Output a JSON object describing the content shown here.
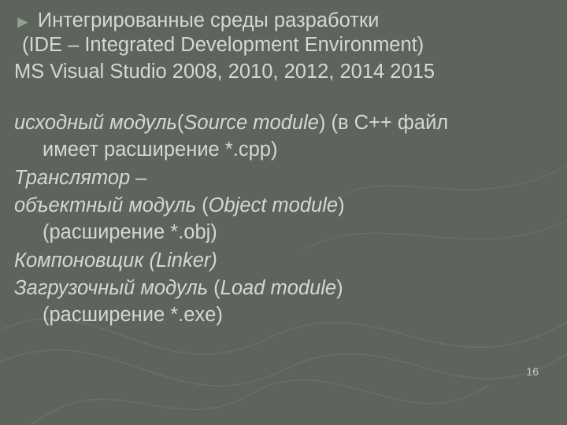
{
  "slide": {
    "bullet_glyph": "►",
    "line1": "Интегрированные среды разработки",
    "line2": "(IDE – Integrated Development Environment)",
    "line3": "MS Visual Studio 2008, 2010, 2012, 2014 2015",
    "para1_a_italic": "исходный модуль",
    "para1_a_plain": "(",
    "para1_a_italic2": "Source module",
    "para1_a_plain2": ") (в С++ файл",
    "para1_b": "имеет расширение *.cpp)",
    "para2_italic": "Транслятор",
    "para2_plain": " –",
    "para3_a_italic": "объектный модуль",
    "para3_a_plain": " (",
    "para3_a_italic2": "Object module",
    "para3_a_plain2": ")",
    "para3_b": "(расширение *.obj)",
    "para4_italic": "Компоновщик (Linker)",
    "para5_a_italic": "Загрузочный модуль",
    "para5_a_plain": " (",
    "para5_a_italic2": "Load module",
    "para5_a_plain2": ")",
    "para5_b": "(расширение *.exe)",
    "page_number": "16"
  }
}
